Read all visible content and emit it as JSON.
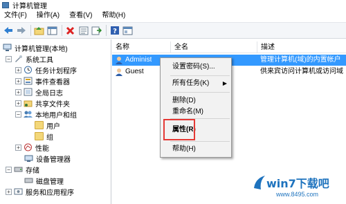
{
  "window": {
    "title": "计算机管理"
  },
  "menu": [
    "文件(F)",
    "操作(A)",
    "查看(V)",
    "帮助(H)"
  ],
  "toolbar": {
    "icons": [
      "back-icon",
      "forward-icon",
      "up-folder-icon",
      "view-icon",
      "delete-icon",
      "properties-icon",
      "export-icon",
      "help-icon",
      "console-icon"
    ]
  },
  "tree": [
    {
      "label": "计算机管理(本地)"
    },
    {
      "label": "系统工具"
    },
    {
      "label": "任务计划程序"
    },
    {
      "label": "事件查看器"
    },
    {
      "label": "全局日志"
    },
    {
      "label": "共享文件夹"
    },
    {
      "label": "本地用户和组"
    },
    {
      "label": "用户"
    },
    {
      "label": "组"
    },
    {
      "label": "性能"
    },
    {
      "label": "设备管理器"
    },
    {
      "label": "存储"
    },
    {
      "label": "磁盘管理"
    },
    {
      "label": "服务和应用程序"
    }
  ],
  "list": {
    "columns": [
      "名称",
      "全名",
      "描述"
    ],
    "rows": [
      {
        "name": "Administ",
        "fullname": "",
        "desc": "管理计算机(域)的内置帐户"
      },
      {
        "name": "Guest",
        "fullname": "",
        "desc": "供来宾访问计算机或访问域"
      }
    ]
  },
  "context_menu": {
    "set_password": "设置密码(S)...",
    "all_tasks": "所有任务(K)",
    "delete": "删除(D)",
    "rename": "重命名(M)",
    "properties": "属性(R)",
    "help": "帮助(H)"
  },
  "watermark": {
    "main": "win7下载吧",
    "sub": "www.8495.com"
  },
  "colors": {
    "selection": "#3399ff",
    "highlight_box": "#e53935",
    "watermark": "#1e73be"
  }
}
